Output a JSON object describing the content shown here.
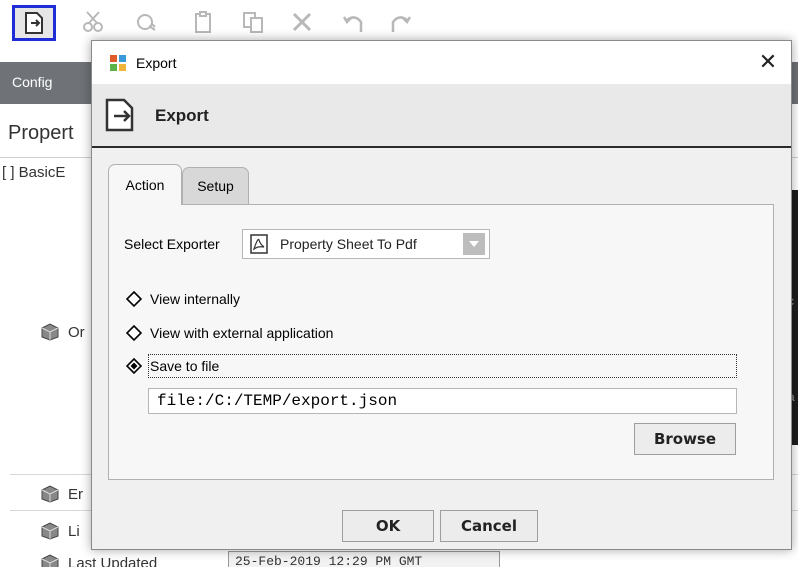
{
  "app": {
    "config_tab": "Config",
    "property_sheet_title": "Propert",
    "basic_row": "[ ] BasicE",
    "rows": [
      "Or",
      "Er",
      "Li",
      "Last Updated"
    ],
    "last_updated_value": "25-Feb-2019 12:29 PM GMT",
    "toolbar_icons": [
      "export-icon",
      "cut-icon",
      "copy-icon",
      "paste-icon",
      "duplicate-icon",
      "delete-icon",
      "undo-icon",
      "redo-icon"
    ],
    "right_strip_fragments": [
      "c",
      "a"
    ]
  },
  "dialog": {
    "window_title": "Export",
    "close_glyph": "✕",
    "header_title": "Export",
    "tabs": [
      {
        "label": "Action",
        "active": true
      },
      {
        "label": "Setup",
        "active": false
      }
    ],
    "select_exporter_label": "Select Exporter",
    "exporter_value": "Property Sheet To Pdf",
    "options": [
      {
        "label": "View internally",
        "selected": false
      },
      {
        "label": "View with external application",
        "selected": false
      },
      {
        "label": "Save to file",
        "selected": true
      }
    ],
    "file_path": "file:/C:/TEMP/export.json",
    "browse_label": "Browse",
    "ok_label": "OK",
    "cancel_label": "Cancel"
  },
  "colors": {
    "highlight_border": "#1f2dd6",
    "config_bar": "#6f7377"
  }
}
